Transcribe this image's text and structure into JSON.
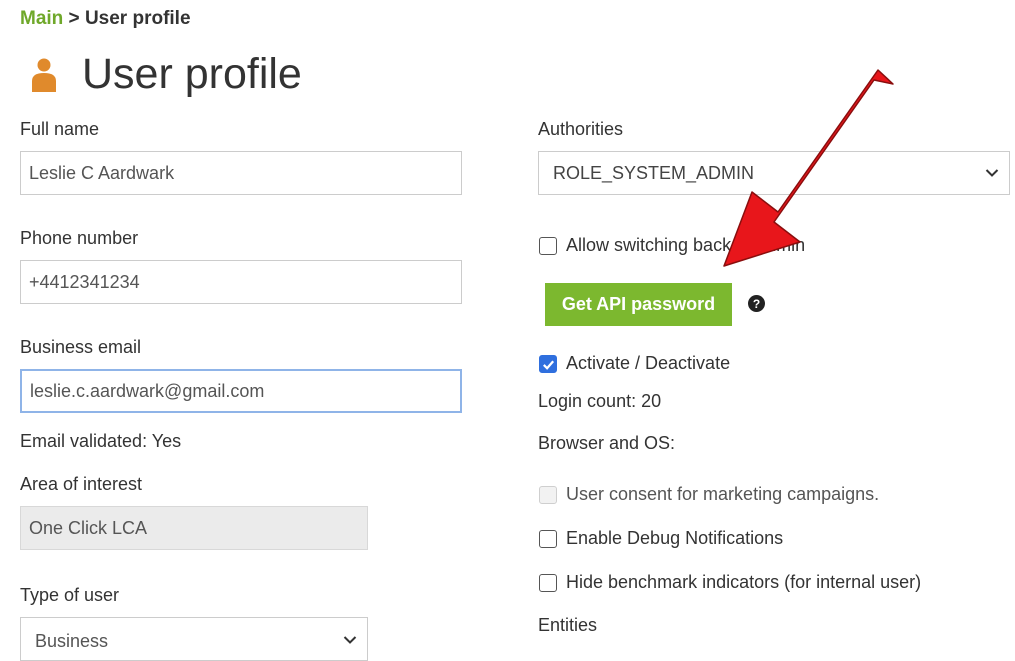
{
  "breadcrumb": {
    "main": "Main",
    "separator": " > ",
    "current": "User profile"
  },
  "page": {
    "title": "User profile"
  },
  "form": {
    "full_name": {
      "label": "Full name",
      "value": "Leslie C Aardwark"
    },
    "phone": {
      "label": "Phone number",
      "value": "+4412341234"
    },
    "email": {
      "label": "Business email",
      "value": "leslie.c.aardwark@gmail.com"
    },
    "email_validated": "Email validated: Yes",
    "area_of_interest": {
      "label": "Area of interest",
      "value": "One Click LCA"
    },
    "type_of_user": {
      "label": "Type of user",
      "value": "Business"
    },
    "authorities": {
      "label": "Authorities",
      "value": "ROLE_SYSTEM_ADMIN"
    },
    "allow_switching": {
      "label": "Allow switching back to admin",
      "checked": false
    },
    "api_button": "Get API password",
    "help_glyph": "?",
    "activate": {
      "label": "Activate / Deactivate",
      "checked": true
    },
    "login_count": "Login count: 20",
    "browser_os": "Browser and OS:",
    "marketing_consent": {
      "label": "User consent for marketing campaigns.",
      "checked": false,
      "disabled": true
    },
    "debug_notifications": {
      "label": "Enable Debug Notifications",
      "checked": false
    },
    "hide_benchmark": {
      "label": "Hide benchmark indicators (for internal user)",
      "checked": false
    },
    "entities": "Entities"
  },
  "colors": {
    "accent_green": "#7cb82f",
    "link_green": "#6fa82a",
    "user_icon": "#e08a2c",
    "arrow_red": "#e8161b",
    "checkbox_blue": "#2f6fde"
  },
  "icons": {
    "user": "user-icon",
    "help": "help-icon",
    "dropdown": "chevron-down-icon",
    "check": "check-icon",
    "annotation": "arrow-annotation-icon"
  }
}
